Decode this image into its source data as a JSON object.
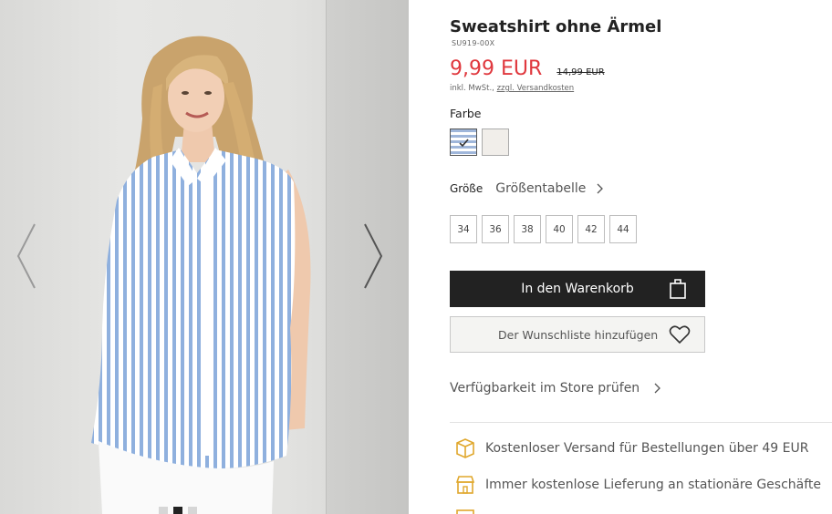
{
  "product": {
    "title": "Sweatshirt ohne Ärmel",
    "sku": "SU919-00X",
    "price": "9,99 EUR",
    "old_price": "14,99 EUR",
    "tax_prefix": "inkl. MwSt.,",
    "shipping_link": "zzgl. Versandkosten"
  },
  "colors": {
    "label": "Farbe",
    "options": [
      {
        "name": "blue-white-stripes",
        "selected": true
      },
      {
        "name": "cream",
        "selected": false
      }
    ]
  },
  "sizes": {
    "label": "Größe",
    "chart_link": "Größentabelle",
    "options": [
      "34",
      "36",
      "38",
      "40",
      "42",
      "44"
    ]
  },
  "actions": {
    "add_to_cart": "In den Warenkorb",
    "add_to_wishlist": "Der Wunschliste hinzufügen",
    "store_availability": "Verfügbarkeit im Store prüfen"
  },
  "benefits": [
    {
      "icon": "parcel-icon",
      "text": "Kostenloser Versand für Bestellungen über 49 EUR"
    },
    {
      "icon": "store-icon",
      "text": "Immer kostenlose Lieferung an stationäre Geschäfte"
    },
    {
      "icon": "calendar-icon",
      "text": ""
    }
  ],
  "gallery": {
    "active_index": 0,
    "slide_count": 3
  },
  "theme": {
    "price_color": "#e0383e",
    "icon_color": "#e0a72c",
    "button_dark": "#222222"
  }
}
